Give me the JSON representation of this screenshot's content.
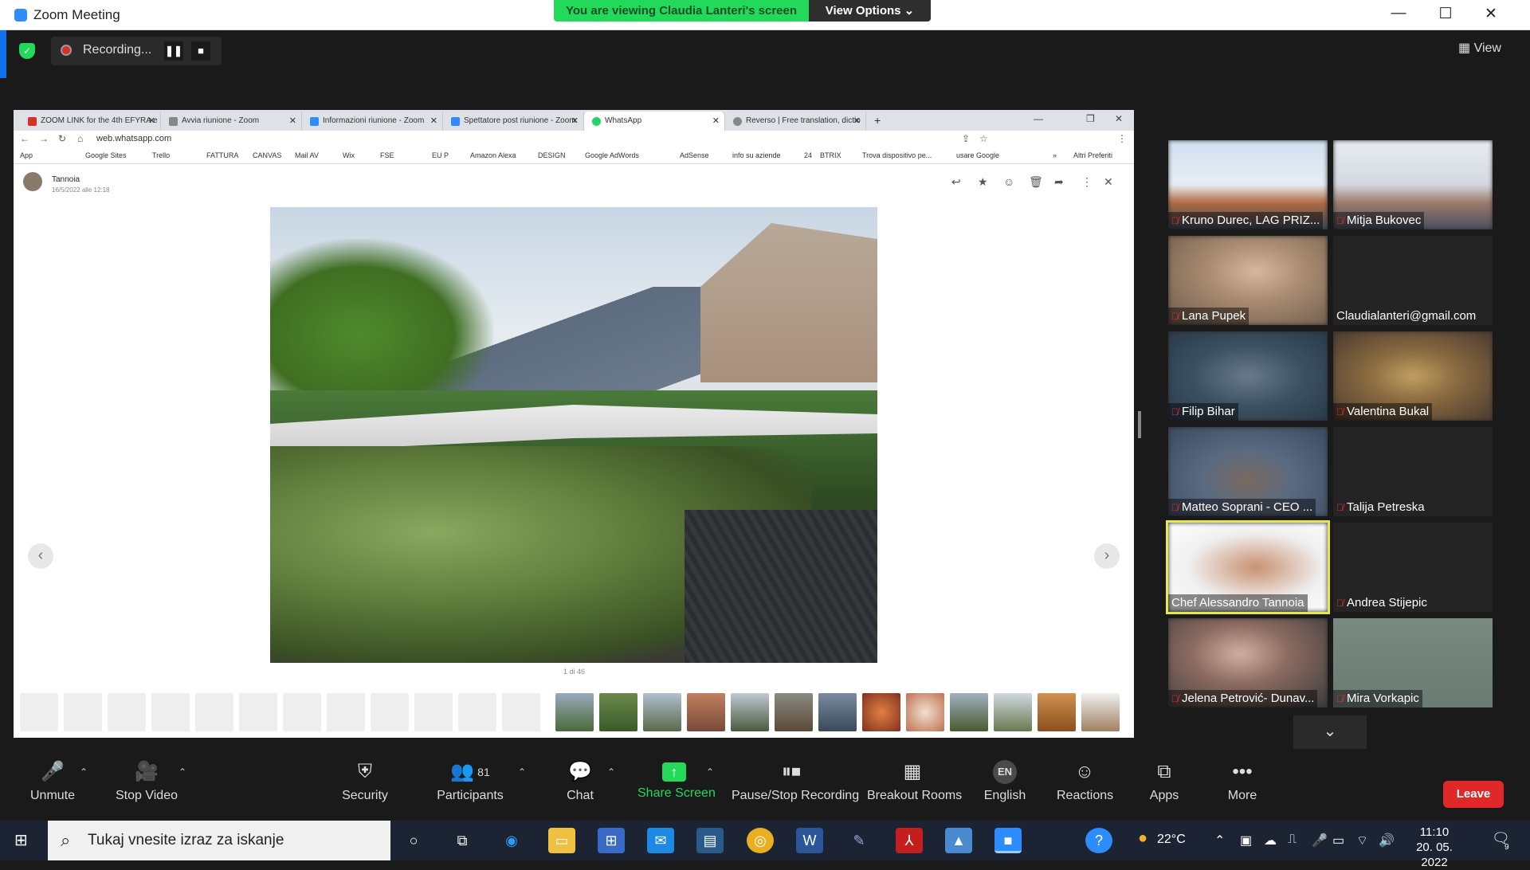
{
  "window": {
    "title": "Zoom Meeting",
    "minimize": "—",
    "maximize": "☐",
    "close": "✕"
  },
  "banner": {
    "viewing": "You are viewing Claudia Lanteri's screen",
    "view_options": "View Options ⌄"
  },
  "recording": {
    "label": "Recording...",
    "pause": "❚❚",
    "stop": "■"
  },
  "view_button": "View",
  "browser": {
    "tabs": [
      {
        "title": "ZOOM LINK for the 4th EFYRA e",
        "color": "#d93025"
      },
      {
        "title": "Avvia riunione - Zoom",
        "color": "#888888"
      },
      {
        "title": "Informazioni riunione - Zoom",
        "color": "#2d8cff"
      },
      {
        "title": "Spettatore post riunione - Zoom",
        "color": "#2d8cff"
      },
      {
        "title": "WhatsApp",
        "color": "#25d366"
      },
      {
        "title": "Reverso | Free translation, dictio",
        "color": "#888888"
      }
    ],
    "new_tab": "+",
    "url": "web.whatsapp.com",
    "bookmarks": [
      "App",
      "Google Sites",
      "Trello",
      "FATTURA",
      "CANVAS",
      "Mail AV",
      "Wix",
      "FSE",
      "EU P",
      "Amazon Alexa",
      "DESIGN",
      "Google AdWords",
      "AdSense",
      "info su aziende",
      "24",
      "BTRIX",
      "Trova dispositivo pe...",
      "usare Google",
      "»",
      "Altri Preferiti"
    ]
  },
  "whatsapp": {
    "sender": "Tannoia",
    "date": "16/5/2022 alle 12:18",
    "counter": "1 di 46",
    "prev": "‹",
    "next": "›"
  },
  "participants": [
    {
      "name": "Kruno Durec, LAG PRIZ...",
      "muted": true,
      "bg": "linear-gradient(#cfe0f0,#e8eef4 50%,#b06a40 70%,#3a4a60)"
    },
    {
      "name": "Mitja Bukovec",
      "muted": true,
      "bg": "linear-gradient(#e8ecf2,#d4d8e0 50%,#9a7a6a 70%,#4a5060)"
    },
    {
      "name": "Lana Pupek",
      "muted": true,
      "bg": "radial-gradient(ellipse at 55% 40%,#d8b8a0,#a88a70 40%,#6a5a4a)"
    },
    {
      "name": "Claudialanteri@gmail.com",
      "muted": false,
      "bg": "#242424"
    },
    {
      "name": "Filip Bihar",
      "muted": true,
      "bg": "radial-gradient(ellipse at 50% 50%,#6a7a8a,#3a5060 50%,#2a3a4a)"
    },
    {
      "name": "Valentina Bukal",
      "muted": true,
      "bg": "radial-gradient(ellipse at 50% 50%,#c0a060,#8a6a40 40%,#4a3a30)"
    },
    {
      "name": "Matteo Soprani - CEO ...",
      "muted": true,
      "bg": "radial-gradient(ellipse at 50% 60%,#7a6a60,#5a6a80 40%,#3a4a60)"
    },
    {
      "name": "Talija Petreska",
      "muted": true,
      "bg": "#242424"
    },
    {
      "name": "Chef Alessandro Tannoia",
      "muted": false,
      "bg": "radial-gradient(ellipse at 55% 50%,#c89070,#f0f0f0 55%,#ffffff)"
    },
    {
      "name": "Andrea Stijepic",
      "muted": true,
      "bg": "#242424"
    },
    {
      "name": "Jelena Petrović- Dunav...",
      "muted": true,
      "bg": "radial-gradient(ellipse at 45% 40%,#d0b0a0,#8a6a60 40%,#3a3a3a)"
    },
    {
      "name": "Mira Vorkapic",
      "muted": true,
      "bg": "linear-gradient(#7a8a80,#6a7a74)"
    }
  ],
  "toolbar": {
    "unmute": "Unmute",
    "stop_video": "Stop Video",
    "security": "Security",
    "participants": "Participants",
    "participant_count": "81",
    "chat": "Chat",
    "share_screen": "Share Screen",
    "pause_stop_recording": "Pause/Stop Recording",
    "breakout_rooms": "Breakout Rooms",
    "language_code": "EN",
    "language": "English",
    "reactions": "Reactions",
    "apps": "Apps",
    "more": "More",
    "leave": "Leave"
  },
  "taskbar": {
    "search_placeholder": "Tukaj vnesite izraz za iskanje",
    "temperature": "22°C",
    "time": "11:10",
    "date": "20. 05. 2022",
    "notifications": "9"
  }
}
